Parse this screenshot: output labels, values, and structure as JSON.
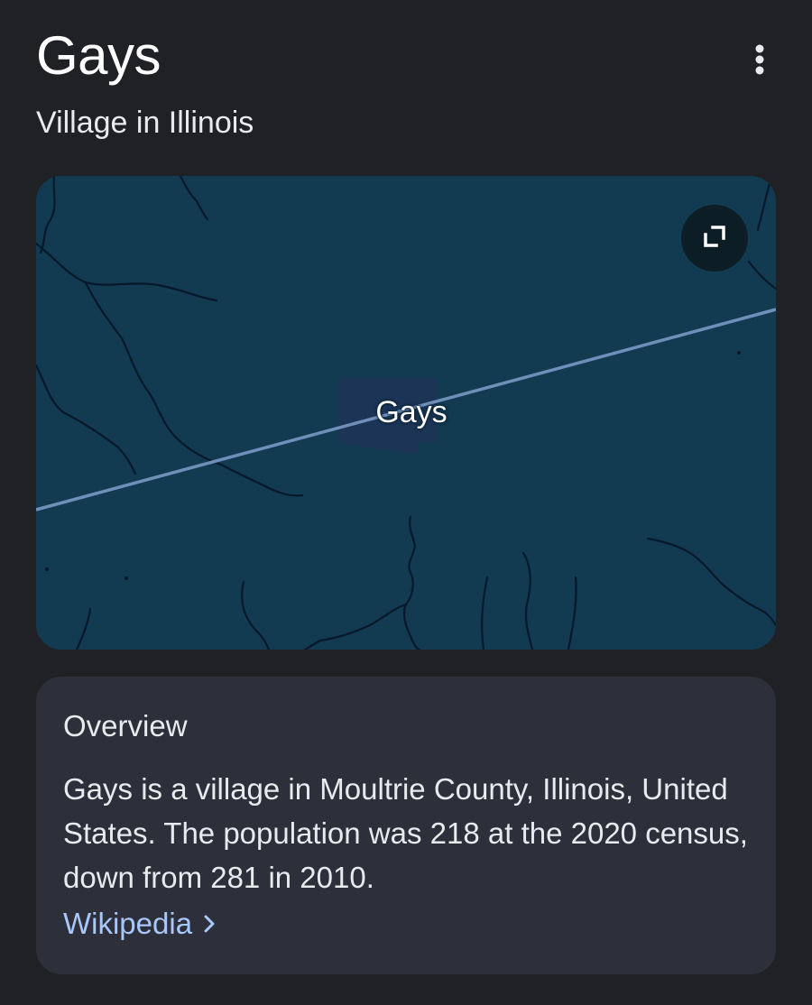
{
  "header": {
    "title": "Gays",
    "subtitle": "Village in Illinois",
    "menu_icon": "more-vert-icon"
  },
  "map": {
    "place_label": "Gays",
    "expand_icon": "expand-icon",
    "colors": {
      "water_background": "#123a51",
      "rivers": "#06192a",
      "road": "#6f8fb8",
      "place_area": "#1c3456"
    }
  },
  "overview": {
    "heading": "Overview",
    "text": "Gays is a village in Moultrie County, Illinois, United States. The population was 218 at the 2020 census, down from 281 in 2010.",
    "source_label": "Wikipedia",
    "source_icon": "chevron-right-icon",
    "link_color": "#a8c7fa"
  }
}
